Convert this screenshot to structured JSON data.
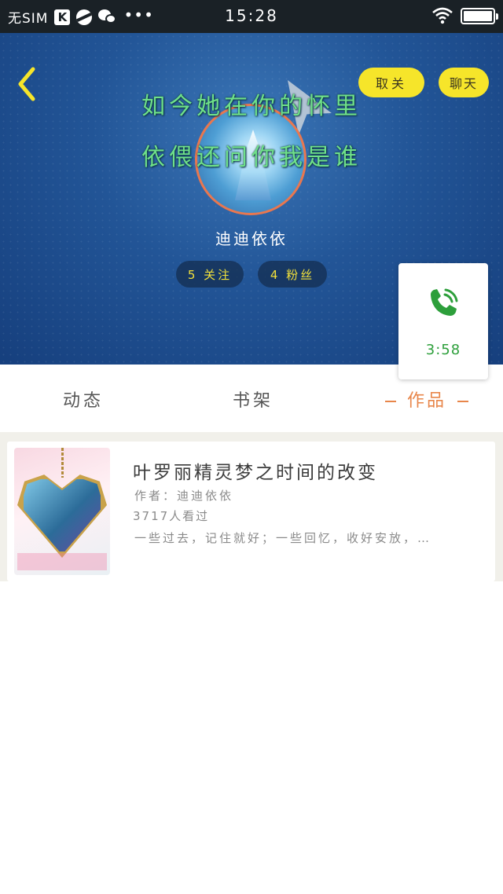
{
  "status_bar": {
    "sim": "无SIM",
    "app_badge": "K",
    "time": "15:28",
    "overflow": "•••"
  },
  "header": {
    "unfollow_label": "取关",
    "chat_label": "聊天",
    "lyric_line_1": "如今她在你的怀里",
    "lyric_line_2": "依偎还问你我是谁",
    "username": "迪迪依依",
    "following": "5 关注",
    "followers": "4 粉丝",
    "lyric_color": "#6fe08a",
    "accent_yellow": "#f6e52a"
  },
  "call_card": {
    "duration": "3:58",
    "icon": "phone-icon",
    "color": "#2d9f3b"
  },
  "tabs": [
    {
      "label": "动态",
      "active": false
    },
    {
      "label": "书架",
      "active": false
    },
    {
      "label": "作品",
      "active": true
    }
  ],
  "works": [
    {
      "title": "叶罗丽精灵梦之时间的改变",
      "author": "作者：迪迪依依",
      "views": "3717人看过",
      "summary": "一些过去，记住就好；一些回忆，收好安放，…"
    }
  ],
  "colors": {
    "active_tab": "#e8864a",
    "status_bar_bg": "#1a2126"
  }
}
